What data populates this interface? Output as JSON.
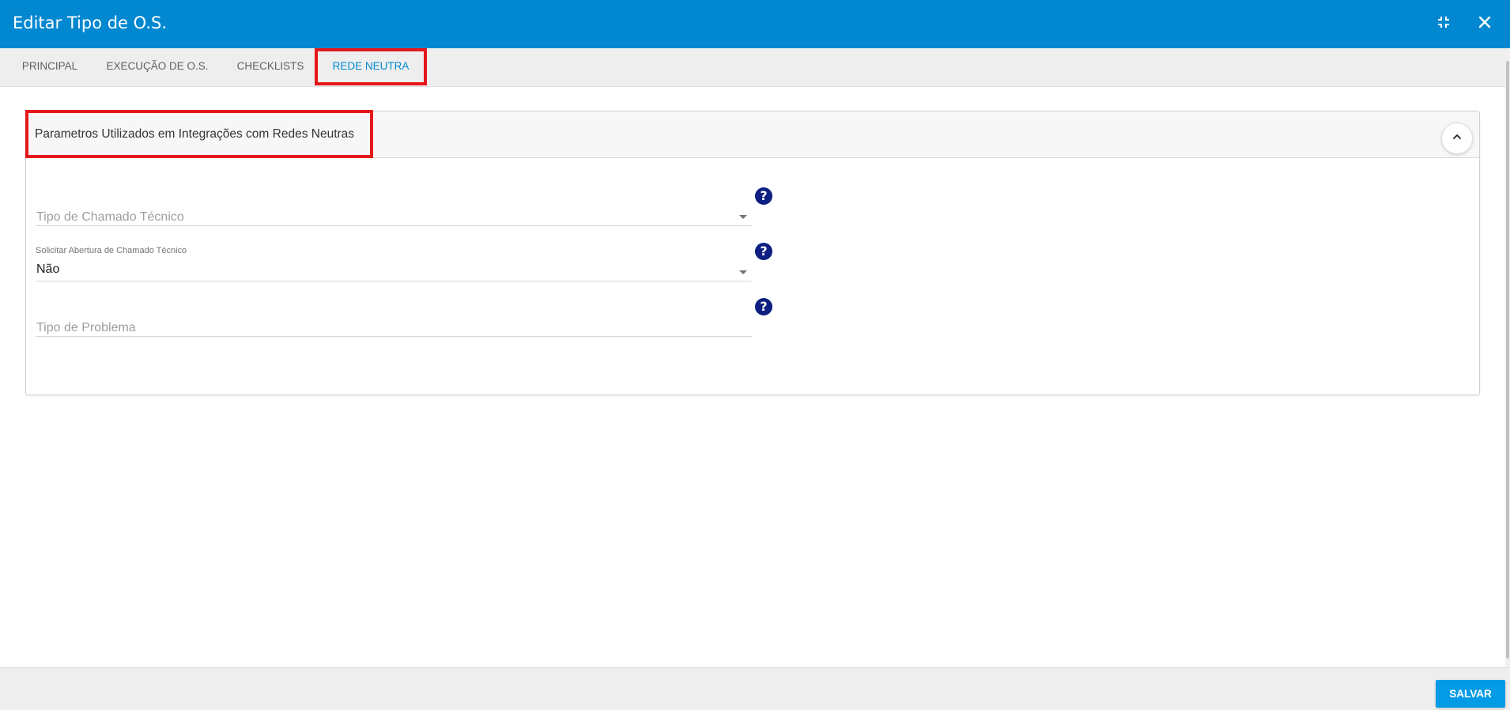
{
  "header": {
    "title": "Editar Tipo de O.S.",
    "minimize_icon": "collapse-arrows-icon",
    "close_icon": "close-icon"
  },
  "tabs": [
    {
      "label": "PRINCIPAL",
      "active": false
    },
    {
      "label": "EXECUÇÃO DE O.S.",
      "active": false
    },
    {
      "label": "CHECKLISTS",
      "active": false
    },
    {
      "label": "REDE NEUTRA",
      "active": true
    }
  ],
  "panel": {
    "title": "Parametros Utilizados em Integrações com Redes Neutras",
    "collapse_icon": "chevron-up-icon",
    "fields": [
      {
        "label": "",
        "placeholder": "Tipo de Chamado Técnico",
        "value": "",
        "type": "select"
      },
      {
        "label": "Solicitar Abertura de Chamado Técnico",
        "placeholder": "",
        "value": "Não",
        "type": "select"
      },
      {
        "label": "",
        "placeholder": "Tipo de Problema",
        "value": "",
        "type": "text"
      }
    ],
    "help_glyph": "?"
  },
  "footer": {
    "save_label": "SALVAR"
  },
  "colors": {
    "header": "#0288d1",
    "accent": "#0288d1",
    "save_button": "#039be5",
    "highlight": "#e5171b",
    "help_icon": "#0d1f80"
  }
}
